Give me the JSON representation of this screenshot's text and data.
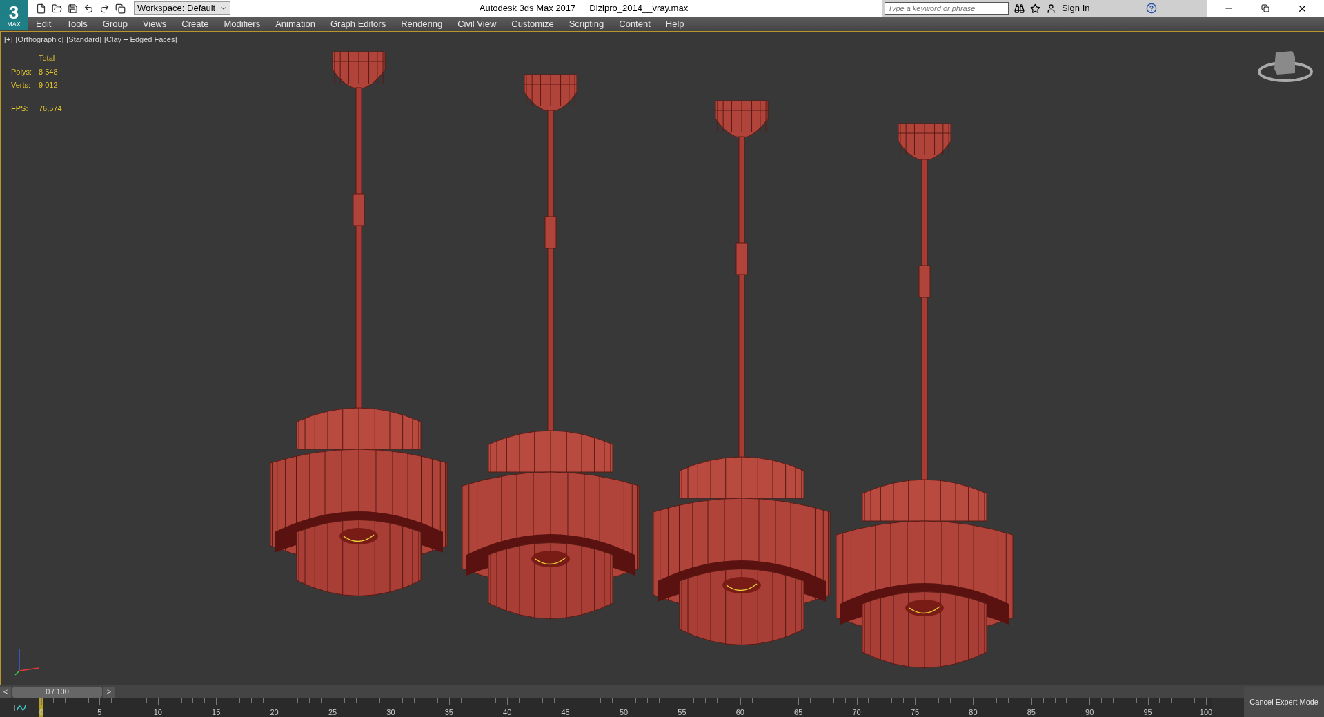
{
  "logo": {
    "text": "3",
    "sub": "MAX"
  },
  "toolbar": {
    "workspace": "Workspace: Default"
  },
  "window": {
    "app": "Autodesk 3ds Max 2017",
    "file": "Dizipro_2014__vray.max"
  },
  "search": {
    "placeholder": "Type a keyword or phrase"
  },
  "account": {
    "label": "Sign In"
  },
  "menu": [
    "Edit",
    "Tools",
    "Group",
    "Views",
    "Create",
    "Modifiers",
    "Animation",
    "Graph Editors",
    "Rendering",
    "Civil View",
    "Customize",
    "Scripting",
    "Content",
    "Help"
  ],
  "viewport": {
    "labels": [
      "[+]",
      "[Orthographic]",
      "[Standard]",
      "[Clay + Edged Faces]"
    ],
    "stats": {
      "header": "Total",
      "rows": [
        {
          "label": "Polys:",
          "value": "8 548"
        },
        {
          "label": "Verts:",
          "value": "9 012"
        },
        {
          "label": "FPS:",
          "value": "76,574"
        }
      ]
    }
  },
  "time_slider": {
    "prev": "<",
    "value": "0 / 100",
    "next": ">"
  },
  "ruler": [
    "0",
    "5",
    "10",
    "15",
    "20",
    "25",
    "30",
    "35",
    "40",
    "45",
    "50",
    "55",
    "60",
    "65",
    "70",
    "75",
    "80",
    "85",
    "90",
    "95",
    "100"
  ],
  "expert_button": "Cancel Expert Mode"
}
